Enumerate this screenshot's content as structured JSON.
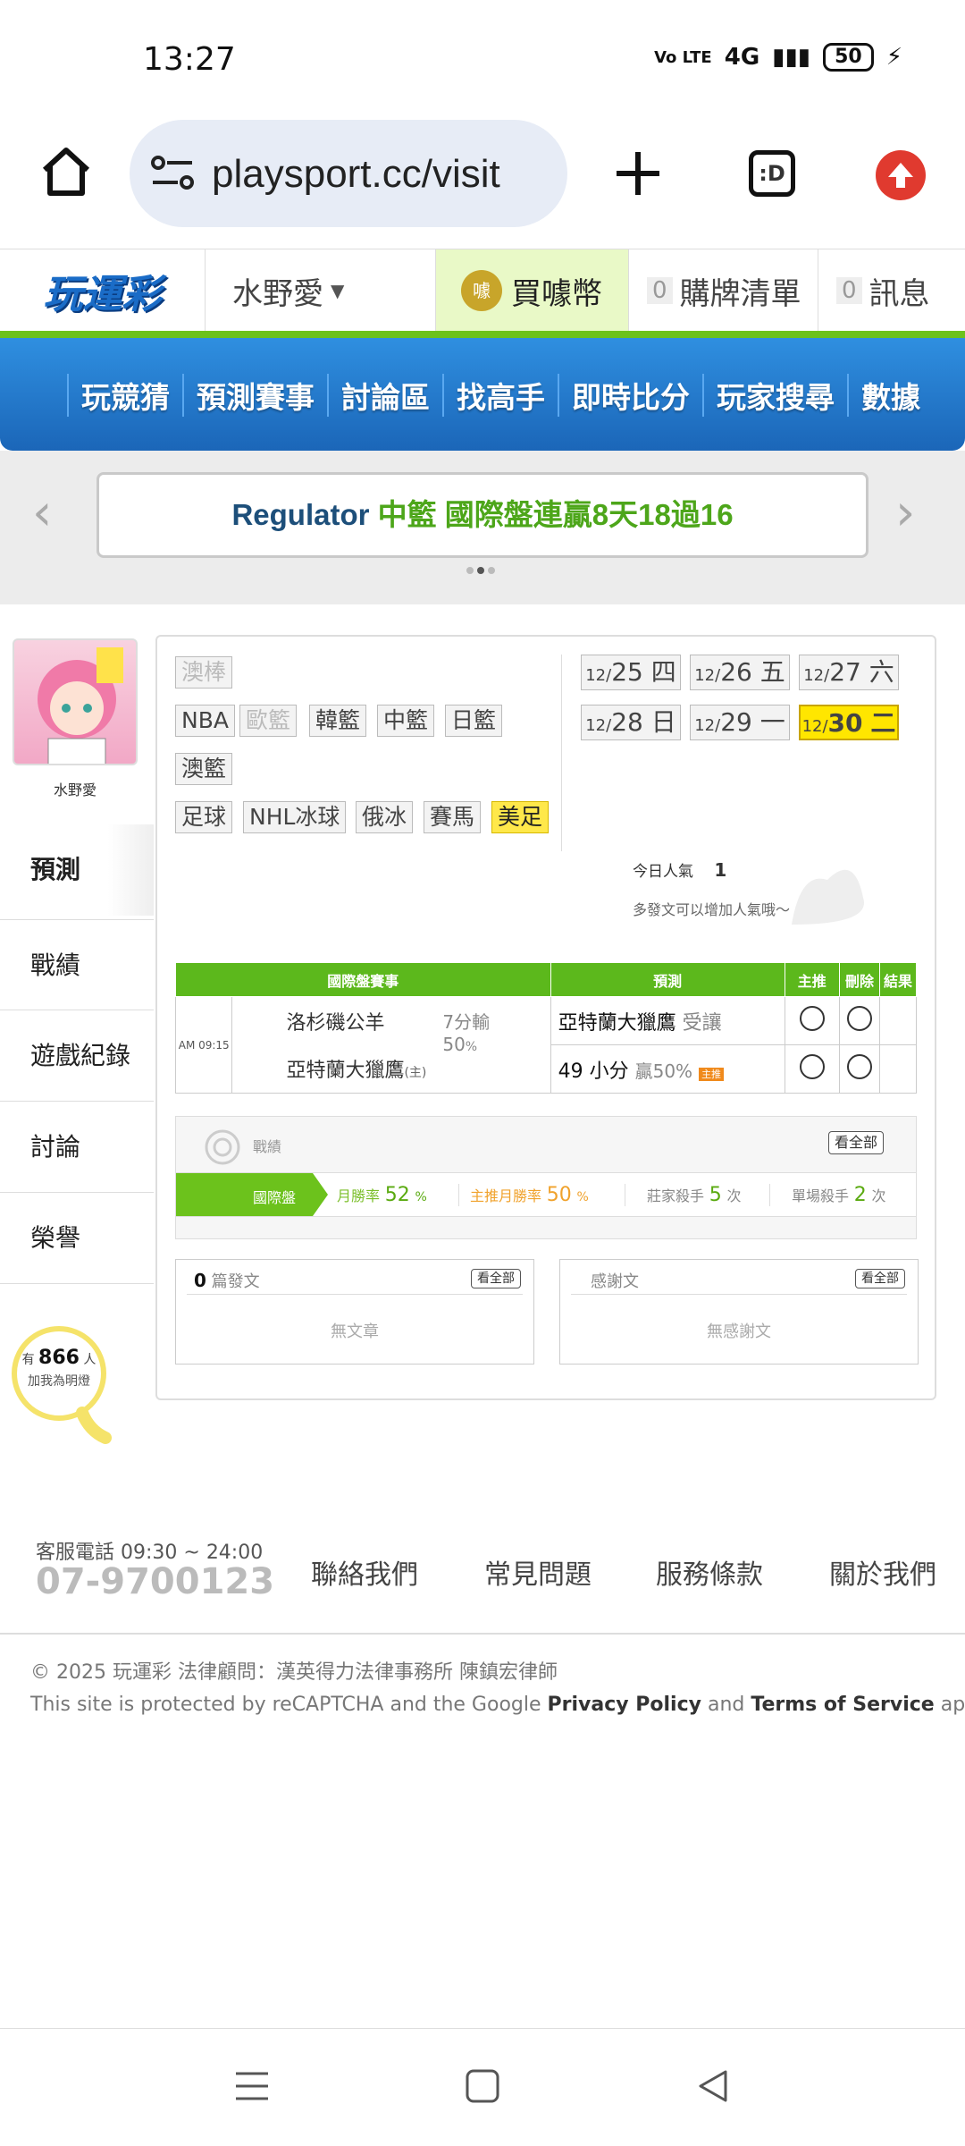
{
  "status": {
    "time": "13:27",
    "network": "4G",
    "volte": "Vo LTE",
    "battery": "50"
  },
  "browser": {
    "url": "playsport.cc/visit",
    "tabs_label": ":D"
  },
  "header": {
    "logo": "玩運彩",
    "username": "水野愛",
    "buy_coins": "買噱幣",
    "coin_badge": "噱",
    "cart_count": "0",
    "cart_label": "購牌清單",
    "msg_count": "0",
    "msg_label": "訊息"
  },
  "nav": {
    "items": [
      "玩競猜",
      "預測賽事",
      "討論區",
      "找高手",
      "即時比分",
      "玩家搜尋",
      "數據"
    ]
  },
  "banner": {
    "part1": "Regulator",
    "part2": "中籃 國際盤連贏8天18過16"
  },
  "profile": {
    "name": "水野愛",
    "menu": [
      "預測",
      "戰績",
      "遊戲紀錄",
      "討論",
      "榮譽"
    ],
    "fans_prefix": "有",
    "fans_count": "866",
    "fans_unit": "人",
    "fans_suffix": "加我為明燈"
  },
  "leagues": {
    "row0": [
      "澳棒"
    ],
    "row1": [
      "NBA",
      "歐籃",
      "韓籃",
      "中籃",
      "日籃"
    ],
    "row2": [
      "澳籃"
    ],
    "row3": [
      "足球",
      "NHL冰球",
      "俄冰",
      "賽馬",
      "美足"
    ]
  },
  "dates": [
    {
      "md": "12/",
      "d": "25",
      "w": "四"
    },
    {
      "md": "12/",
      "d": "26",
      "w": "五"
    },
    {
      "md": "12/",
      "d": "27",
      "w": "六"
    },
    {
      "md": "12/",
      "d": "28",
      "w": "日"
    },
    {
      "md": "12/",
      "d": "29",
      "w": "一"
    },
    {
      "md": "12/",
      "d": "30",
      "w": "二"
    }
  ],
  "popularity": {
    "label": "今日人氣",
    "value": "1",
    "hint": "多發文可以增加人氣哦～"
  },
  "table": {
    "headers": [
      "國際盤賽事",
      "預測",
      "主推",
      "刪除",
      "結果"
    ],
    "time": "AM 09:15",
    "away": "洛杉磯公羊",
    "home": "亞特蘭大獵鷹",
    "home_tag": "(主)",
    "spread": "7分輸",
    "spread_pct": "50",
    "pct_sign": "%",
    "pick1": "亞特蘭大獵鷹",
    "pick1_note": "受讓",
    "pick2": "49 小分",
    "pick2_note": "贏50%",
    "pick2_badge": "主推"
  },
  "record": {
    "title": "戰績",
    "view_all": "看全部",
    "tab": "國際盤",
    "month_win_label": "月勝率",
    "month_win": "52",
    "main_win_label": "主推月勝率",
    "main_win": "50",
    "pct": "%",
    "killer_label": "莊家殺手",
    "killer": "5",
    "single_label": "單場殺手",
    "single": "2",
    "times": "次"
  },
  "posts": {
    "count": "0",
    "label": "篇發文",
    "view_all": "看全部",
    "empty": "無文章"
  },
  "thanks": {
    "label": "感謝文",
    "view_all": "看全部",
    "empty": "無感謝文"
  },
  "footer": {
    "phone_label": "客服電話 09:30 ~ 24:00",
    "phone": "07-9700123",
    "links": [
      "聯絡我們",
      "常見問題",
      "服務條款",
      "關於我們"
    ],
    "copyright": "© 2025 玩運彩 法律顧問：漢英得力法律事務所 陳鎮宏律師",
    "recaptcha_pre": "This site is protected by reCAPTCHA and the Google",
    "privacy": "Privacy Policy",
    "and": "and",
    "terms": "Terms of Service",
    "apply": "apply."
  },
  "colors": {
    "brand_green": "#6cc21c",
    "nav_blue": "#1b66b8",
    "highlight_yellow": "#ffe600"
  }
}
